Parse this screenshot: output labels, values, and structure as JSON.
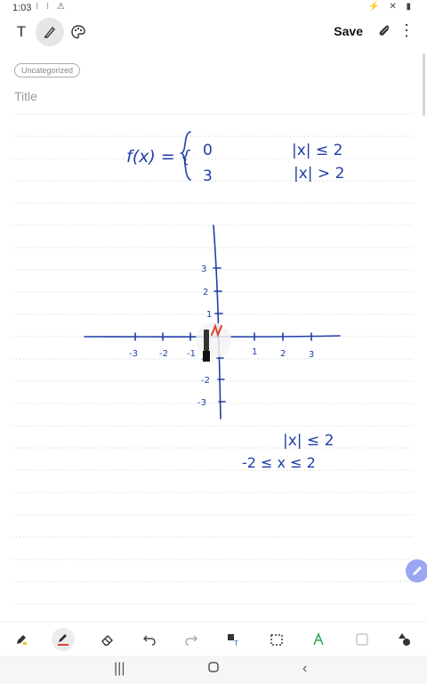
{
  "status": {
    "time": "1:03",
    "left_icons": "⁝ ⁝ ⚠",
    "right_icons": "⚡ ✕ ▮"
  },
  "toolbar": {
    "text_mode_icon": "T",
    "save_label": "Save",
    "clip_icon": "📎",
    "more_icon": "⋮"
  },
  "note": {
    "category": "Uncategorized",
    "title_placeholder": "Title"
  },
  "handwriting": {
    "function_def": "f(x) = {",
    "case1_value": "0",
    "case1_condition": "|x| ≤ 2",
    "case2_value": "3",
    "case2_condition": "|x| > 2",
    "y_ticks": [
      "3",
      "2",
      "1",
      "-1",
      "-2",
      "-3"
    ],
    "x_ticks_neg": [
      "-3",
      "-2",
      "-1"
    ],
    "x_ticks_pos": [
      "1",
      "2",
      "3"
    ],
    "work_line1": "|x| ≤ 2",
    "work_line2": "-2 ≤ x ≤ 2"
  },
  "colors": {
    "ink_blue": "#1f3fa8",
    "ink_red": "#e0442f",
    "ruled_line": "#d9d9d9"
  }
}
